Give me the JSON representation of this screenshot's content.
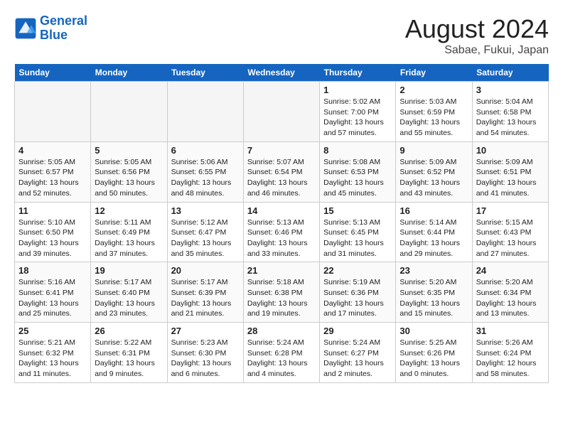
{
  "logo": {
    "line1": "General",
    "line2": "Blue"
  },
  "title": "August 2024",
  "location": "Sabae, Fukui, Japan",
  "weekdays": [
    "Sunday",
    "Monday",
    "Tuesday",
    "Wednesday",
    "Thursday",
    "Friday",
    "Saturday"
  ],
  "weeks": [
    [
      {
        "day": "",
        "empty": true
      },
      {
        "day": "",
        "empty": true
      },
      {
        "day": "",
        "empty": true
      },
      {
        "day": "",
        "empty": true
      },
      {
        "day": "1",
        "sunrise": "5:02 AM",
        "sunset": "7:00 PM",
        "daylight": "13 hours and 57 minutes."
      },
      {
        "day": "2",
        "sunrise": "5:03 AM",
        "sunset": "6:59 PM",
        "daylight": "13 hours and 55 minutes."
      },
      {
        "day": "3",
        "sunrise": "5:04 AM",
        "sunset": "6:58 PM",
        "daylight": "13 hours and 54 minutes."
      }
    ],
    [
      {
        "day": "4",
        "sunrise": "5:05 AM",
        "sunset": "6:57 PM",
        "daylight": "13 hours and 52 minutes."
      },
      {
        "day": "5",
        "sunrise": "5:05 AM",
        "sunset": "6:56 PM",
        "daylight": "13 hours and 50 minutes."
      },
      {
        "day": "6",
        "sunrise": "5:06 AM",
        "sunset": "6:55 PM",
        "daylight": "13 hours and 48 minutes."
      },
      {
        "day": "7",
        "sunrise": "5:07 AM",
        "sunset": "6:54 PM",
        "daylight": "13 hours and 46 minutes."
      },
      {
        "day": "8",
        "sunrise": "5:08 AM",
        "sunset": "6:53 PM",
        "daylight": "13 hours and 45 minutes."
      },
      {
        "day": "9",
        "sunrise": "5:09 AM",
        "sunset": "6:52 PM",
        "daylight": "13 hours and 43 minutes."
      },
      {
        "day": "10",
        "sunrise": "5:09 AM",
        "sunset": "6:51 PM",
        "daylight": "13 hours and 41 minutes."
      }
    ],
    [
      {
        "day": "11",
        "sunrise": "5:10 AM",
        "sunset": "6:50 PM",
        "daylight": "13 hours and 39 minutes."
      },
      {
        "day": "12",
        "sunrise": "5:11 AM",
        "sunset": "6:49 PM",
        "daylight": "13 hours and 37 minutes."
      },
      {
        "day": "13",
        "sunrise": "5:12 AM",
        "sunset": "6:47 PM",
        "daylight": "13 hours and 35 minutes."
      },
      {
        "day": "14",
        "sunrise": "5:13 AM",
        "sunset": "6:46 PM",
        "daylight": "13 hours and 33 minutes."
      },
      {
        "day": "15",
        "sunrise": "5:13 AM",
        "sunset": "6:45 PM",
        "daylight": "13 hours and 31 minutes."
      },
      {
        "day": "16",
        "sunrise": "5:14 AM",
        "sunset": "6:44 PM",
        "daylight": "13 hours and 29 minutes."
      },
      {
        "day": "17",
        "sunrise": "5:15 AM",
        "sunset": "6:43 PM",
        "daylight": "13 hours and 27 minutes."
      }
    ],
    [
      {
        "day": "18",
        "sunrise": "5:16 AM",
        "sunset": "6:41 PM",
        "daylight": "13 hours and 25 minutes."
      },
      {
        "day": "19",
        "sunrise": "5:17 AM",
        "sunset": "6:40 PM",
        "daylight": "13 hours and 23 minutes."
      },
      {
        "day": "20",
        "sunrise": "5:17 AM",
        "sunset": "6:39 PM",
        "daylight": "13 hours and 21 minutes."
      },
      {
        "day": "21",
        "sunrise": "5:18 AM",
        "sunset": "6:38 PM",
        "daylight": "13 hours and 19 minutes."
      },
      {
        "day": "22",
        "sunrise": "5:19 AM",
        "sunset": "6:36 PM",
        "daylight": "13 hours and 17 minutes."
      },
      {
        "day": "23",
        "sunrise": "5:20 AM",
        "sunset": "6:35 PM",
        "daylight": "13 hours and 15 minutes."
      },
      {
        "day": "24",
        "sunrise": "5:20 AM",
        "sunset": "6:34 PM",
        "daylight": "13 hours and 13 minutes."
      }
    ],
    [
      {
        "day": "25",
        "sunrise": "5:21 AM",
        "sunset": "6:32 PM",
        "daylight": "13 hours and 11 minutes."
      },
      {
        "day": "26",
        "sunrise": "5:22 AM",
        "sunset": "6:31 PM",
        "daylight": "13 hours and 9 minutes."
      },
      {
        "day": "27",
        "sunrise": "5:23 AM",
        "sunset": "6:30 PM",
        "daylight": "13 hours and 6 minutes."
      },
      {
        "day": "28",
        "sunrise": "5:24 AM",
        "sunset": "6:28 PM",
        "daylight": "13 hours and 4 minutes."
      },
      {
        "day": "29",
        "sunrise": "5:24 AM",
        "sunset": "6:27 PM",
        "daylight": "13 hours and 2 minutes."
      },
      {
        "day": "30",
        "sunrise": "5:25 AM",
        "sunset": "6:26 PM",
        "daylight": "13 hours and 0 minutes."
      },
      {
        "day": "31",
        "sunrise": "5:26 AM",
        "sunset": "6:24 PM",
        "daylight": "12 hours and 58 minutes."
      }
    ]
  ]
}
